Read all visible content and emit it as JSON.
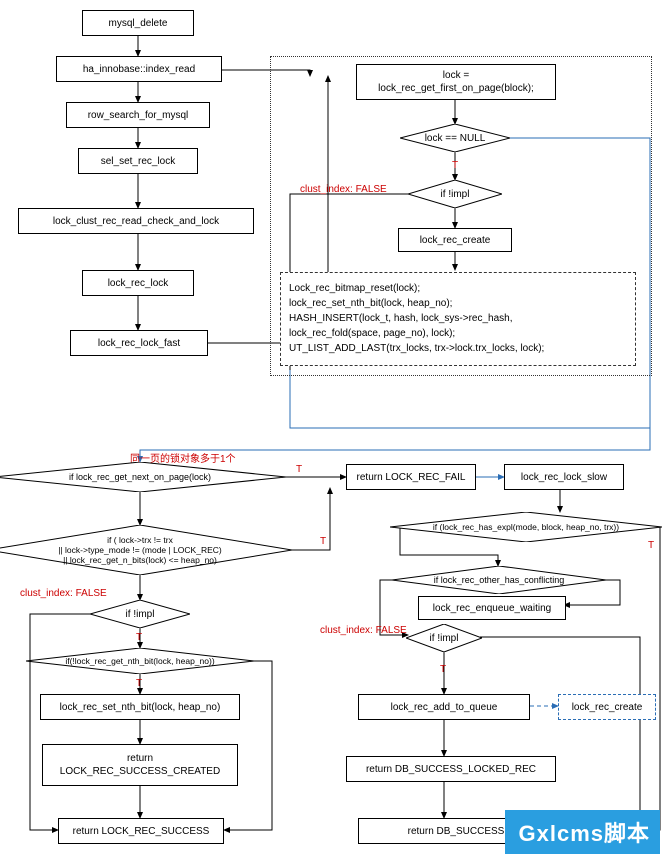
{
  "nodes": {
    "n1": "mysql_delete",
    "n2": "ha_innobase::index_read",
    "n3": "row_search_for_mysql",
    "n4": "sel_set_rec_lock",
    "n5": "lock_clust_rec_read_check_and_lock",
    "n6": "lock_rec_lock",
    "n7": "lock_rec_lock_fast",
    "r1_l1": "lock =",
    "r1_l2": "lock_rec_get_first_on_page(block);",
    "d1": "lock == NULL",
    "d2": "if !impl",
    "r2": "lock_rec_create",
    "code1": "Lock_rec_bitmap_reset(lock);",
    "code2": "lock_rec_set_nth_bit(lock, heap_no);",
    "code3": "HASH_INSERT(lock_t, hash, lock_sys->rec_hash,",
    "code4": "      lock_rec_fold(space, page_no), lock);",
    "code5": "UT_LIST_ADD_LAST(trx_locks, trx->lock.trx_locks, lock);",
    "d3": "if lock_rec_get_next_on_page(lock)",
    "b_fail": "return LOCK_REC_FAIL",
    "b_slow": "lock_rec_lock_slow",
    "d4_l1": "if ( lock->trx != trx",
    "d4_l2": "|| lock->type_mode != (mode | LOCK_REC)",
    "d4_l3": "|| lock_rec_get_n_bits(lock) <= heap_no)",
    "d5": "if !impl",
    "d6": "if(!lock_rec_get_nth_bit(lock, heap_no))",
    "b_setbit": "lock_rec_set_nth_bit(lock, heap_no)",
    "b_succ_created_l1": "return",
    "b_succ_created_l2": "LOCK_REC_SUCCESS_CREATED",
    "b_succ": "return LOCK_REC_SUCCESS",
    "d7": "if (lock_rec_has_expl(mode, block, heap_no, trx))",
    "d8": "if lock_rec_other_has_conflicting",
    "b_enq": "lock_rec_enqueue_waiting",
    "d9": "if !impl",
    "b_addq": "lock_rec_add_to_queue",
    "b_create2": "lock_rec_create",
    "b_db_locked": "return DB_SUCCESS_LOCKED_REC",
    "b_db_succ": "return DB_SUCCESS"
  },
  "labels": {
    "t": "T",
    "same_page": "同一页的锁对象多于1个",
    "clust_false": "clust_index: FALSE"
  },
  "watermark": "Gxlcms脚本"
}
